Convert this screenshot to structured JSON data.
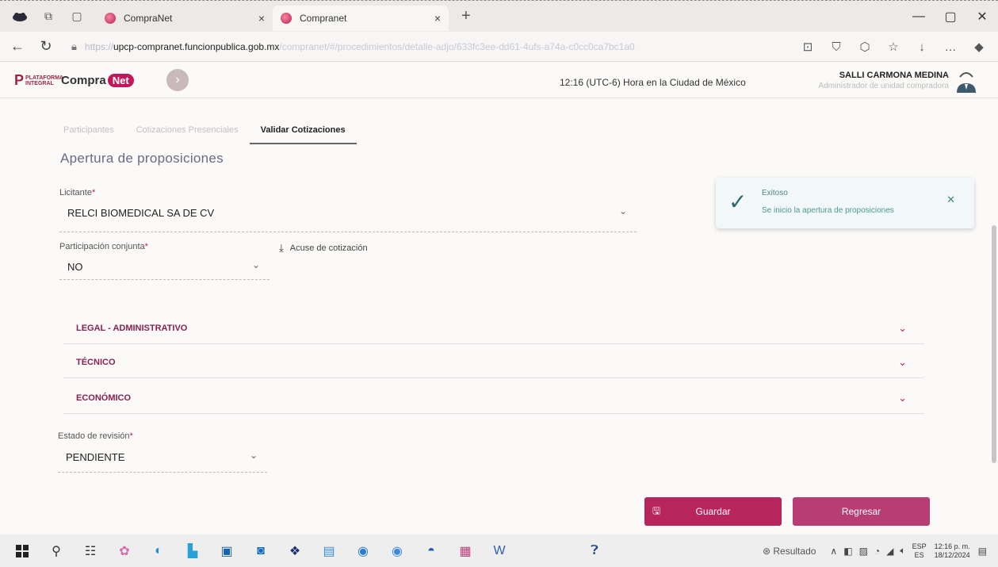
{
  "browser": {
    "tabs": [
      {
        "title": "CompraNet",
        "close": "×"
      },
      {
        "title": "Compranet",
        "close": "×"
      }
    ],
    "new_tab": "+",
    "window_controls": [
      "—",
      "▢",
      "✕"
    ],
    "url": {
      "protocol": "https://",
      "host": "upcp-compranet.funcionpublica.gob.mx",
      "path": "/compranet/#/procedimientos/detalle-adjo/633fc3ee-dd61-4ufs-a74a-c0cc0ca7bc1a0"
    }
  },
  "app": {
    "logo": {
      "plataforma": "PLATAFORMA INTEGRAL",
      "compra": "Compra",
      "net": "Net"
    },
    "clock": "12:16 (UTC-6) Hora en la Ciudad de México",
    "user": {
      "name": "SALLI CARMONA MEDINA",
      "role": "Administrador de unidad compradora"
    }
  },
  "page": {
    "tabs": [
      {
        "label": "Participantes",
        "active": false
      },
      {
        "label": "Cotizaciones Presenciales",
        "active": false
      },
      {
        "label": "Validar Cotizaciones",
        "active": true
      }
    ],
    "section_title": "Apertura de proposiciones",
    "licitante": {
      "label": "Licitante",
      "value": "RELCI BIOMEDICAL SA DE CV"
    },
    "participacion": {
      "label": "Participación conjunta",
      "value": "NO"
    },
    "acuse_label": "Acuse de cotización",
    "accordions": [
      "LEGAL - ADMINISTRATIVO",
      "TÉCNICO",
      "ECONÓMICO"
    ],
    "estado": {
      "label": "Estado de revisión",
      "value": "PENDIENTE"
    },
    "required_mark": "*",
    "buttons": {
      "save": "Guardar",
      "back": "Regresar"
    }
  },
  "toast": {
    "title": "Exitoso",
    "message": "Se inicio la apertura de proposiciones"
  },
  "taskbar": {
    "search_text": "Resultado",
    "lang_top": "ESP",
    "lang_bottom": "ES",
    "time": "12:16 p. m.",
    "date": "18/12/2024"
  },
  "colors": {
    "brand": "#b7245e",
    "accent": "#9d2449",
    "success": "#2d6a6e"
  }
}
